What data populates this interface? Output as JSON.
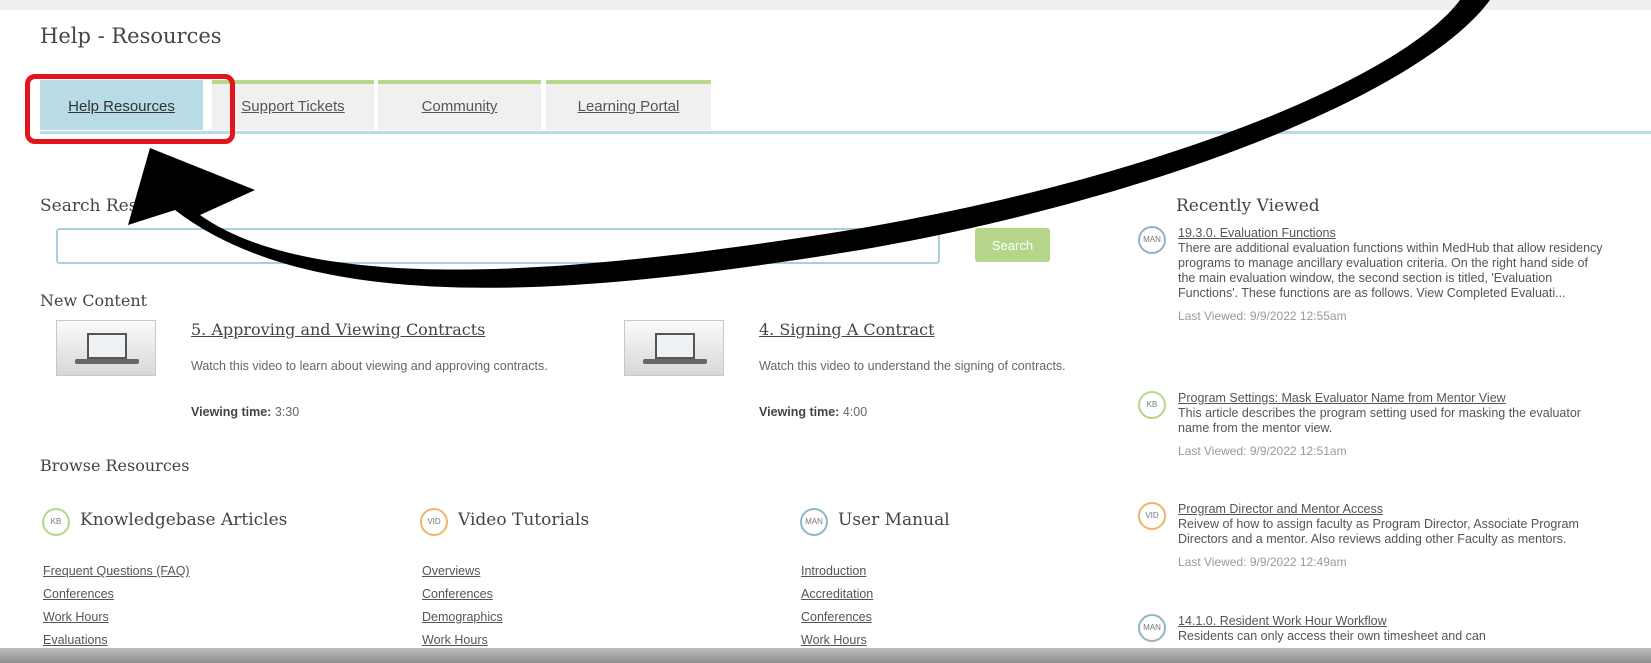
{
  "page": {
    "title": "Help - Resources"
  },
  "tabs": [
    {
      "label": "Help Resources",
      "active": true
    },
    {
      "label": "Support Tickets",
      "active": false
    },
    {
      "label": "Community",
      "active": false
    },
    {
      "label": "Learning Portal",
      "active": false
    }
  ],
  "search": {
    "heading": "Search Resources",
    "placeholder": "",
    "value": "",
    "button_label": "Search"
  },
  "new_content": {
    "heading": "New Content",
    "items": [
      {
        "title": "5. Approving and Viewing Contracts",
        "description": "Watch this video to learn about viewing and approving contracts.",
        "time_label": "Viewing time:",
        "time_value": "3:30"
      },
      {
        "title": "4. Signing A Contract",
        "description": "Watch this video to understand the signing of contracts.",
        "time_label": "Viewing time:",
        "time_value": "4:00"
      }
    ]
  },
  "browse": {
    "heading": "Browse Resources",
    "categories": [
      {
        "badge": "KB",
        "title": "Knowledgebase Articles",
        "links": [
          "Frequent Questions (FAQ)",
          "Conferences",
          "Work Hours",
          "Evaluations"
        ]
      },
      {
        "badge": "VID",
        "title": "Video Tutorials",
        "links": [
          "Overviews",
          "Conferences",
          "Demographics",
          "Work Hours"
        ]
      },
      {
        "badge": "MAN",
        "title": "User Manual",
        "links": [
          "Introduction",
          "Accreditation",
          "Conferences",
          "Work Hours"
        ]
      }
    ]
  },
  "recently_viewed": {
    "heading": "Recently Viewed",
    "items": [
      {
        "badge": "MAN",
        "title": "19.3.0. Evaluation Functions",
        "description": "There are additional evaluation functions within MedHub that allow residency programs to manage ancillary evaluation criteria. On the right hand side of the main evaluation window, the second section is titled, 'Evaluation Functions'. These functions are as follows. View Completed Evaluati...",
        "last_viewed": "Last Viewed: 9/9/2022 12:55am"
      },
      {
        "badge": "KB",
        "title": "Program Settings: Mask Evaluator Name from Mentor View",
        "description": "This article describes the program setting used for masking the evaluator name from the mentor view.",
        "last_viewed": "Last Viewed: 9/9/2022 12:51am"
      },
      {
        "badge": "VID",
        "title": "Program Director and Mentor Access",
        "description": "Reivew of how to assign faculty as Program Director, Associate Program Directors and a mentor. Also reviews adding other Faculty as mentors.",
        "last_viewed": "Last Viewed: 9/9/2022 12:49am"
      },
      {
        "badge": "MAN",
        "title": "14.1.0. Resident Work Hour Workflow",
        "description": "Residents can only access their own timesheet and can",
        "last_viewed": ""
      }
    ]
  },
  "colors": {
    "tab_active": "#b9dbe6",
    "tab_accent": "#b8d98d",
    "highlight_box": "#e3141c",
    "search_button": "#b5d68a",
    "annotation_arrow": "#000000"
  }
}
